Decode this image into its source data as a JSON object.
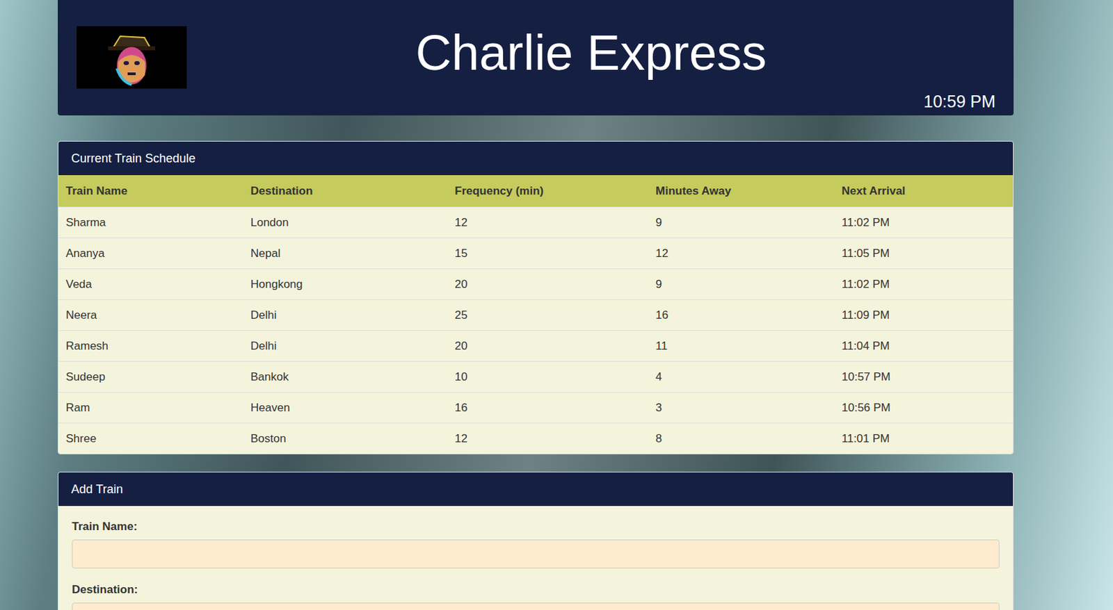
{
  "header": {
    "title": "Charlie Express",
    "time": "10:59 PM"
  },
  "schedule": {
    "title": "Current Train Schedule",
    "columns": [
      "Train Name",
      "Destination",
      "Frequency (min)",
      "Minutes Away",
      "Next Arrival"
    ],
    "rows": [
      [
        "Sharma",
        "London",
        "12",
        "9",
        "11:02 PM"
      ],
      [
        "Ananya",
        "Nepal",
        "15",
        "12",
        "11:05 PM"
      ],
      [
        "Veda",
        "Hongkong",
        "20",
        "9",
        "11:02 PM"
      ],
      [
        "Neera",
        "Delhi",
        "25",
        "16",
        "11:09 PM"
      ],
      [
        "Ramesh",
        "Delhi",
        "20",
        "11",
        "11:04 PM"
      ],
      [
        "Sudeep",
        "Bankok",
        "10",
        "4",
        "10:57 PM"
      ],
      [
        "Ram",
        "Heaven",
        "16",
        "3",
        "10:56 PM"
      ],
      [
        "Shree",
        "Boston",
        "12",
        "8",
        "11:01 PM"
      ]
    ]
  },
  "form": {
    "title": "Add Train",
    "fields": [
      {
        "label": "Train Name:",
        "value": ""
      },
      {
        "label": "Destination:",
        "value": ""
      }
    ]
  }
}
